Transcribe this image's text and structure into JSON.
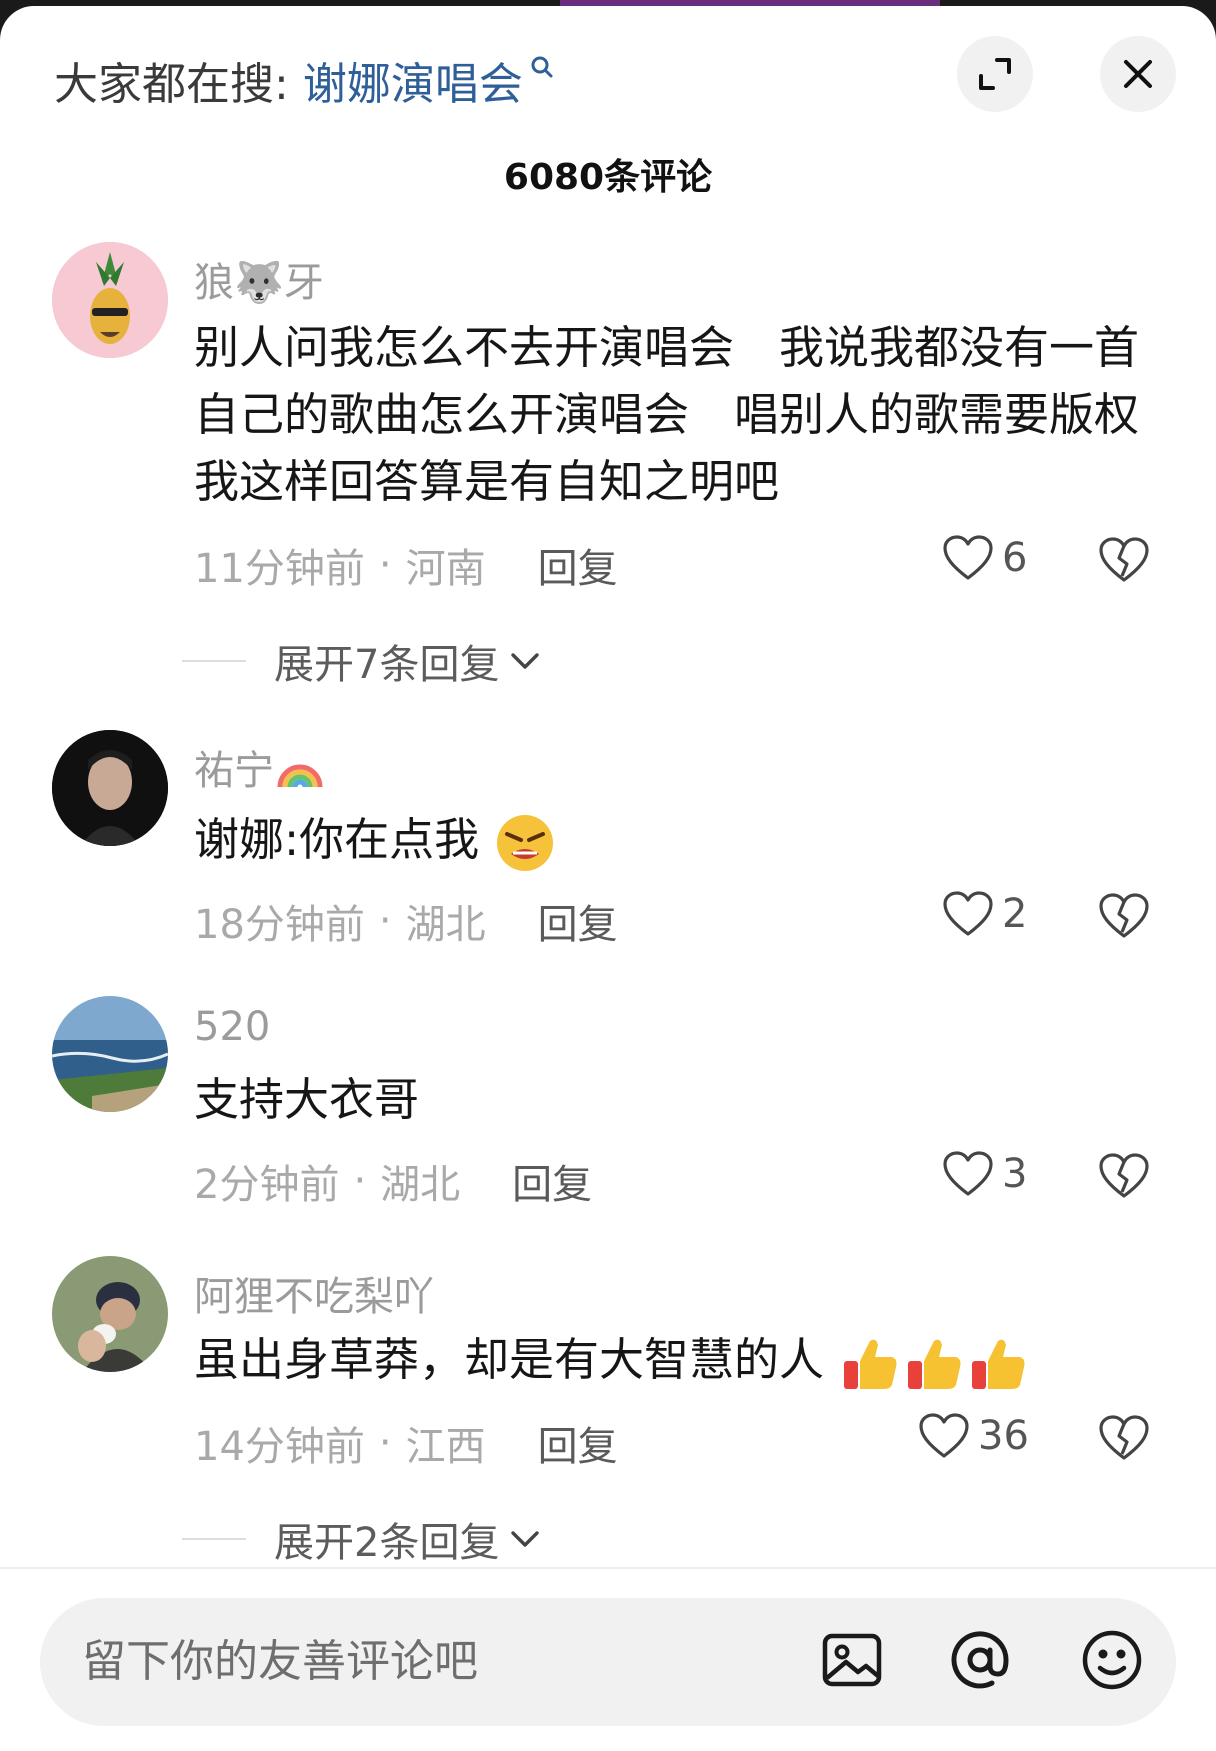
{
  "header": {
    "search_prefix": "大家都在搜:",
    "search_term": "谢娜演唱会",
    "comment_count_title": "6080条评论"
  },
  "comments": [
    {
      "username": "狼🐺牙",
      "text": "别人问我怎么不去开演唱会　我说我都没有一首自己的歌曲怎么开演唱会　唱别人的歌需要版权　我这样回答算是有自知之明吧",
      "time": "11分钟前",
      "location": "河南",
      "reply_label": "回复",
      "likes": "6",
      "expand_replies": "展开7条回复"
    },
    {
      "username": "祐宁",
      "text": "谢娜:你在点我",
      "time": "18分钟前",
      "location": "湖北",
      "reply_label": "回复",
      "likes": "2"
    },
    {
      "username": "520",
      "text": "支持大衣哥",
      "time": "2分钟前",
      "location": "湖北",
      "reply_label": "回复",
      "likes": "3"
    },
    {
      "username": "阿狸不吃梨吖",
      "text": "虽出身草莽，却是有大智慧的人",
      "time": "14分钟前",
      "location": "江西",
      "reply_label": "回复",
      "likes": "36",
      "expand_replies": "展开2条回复"
    }
  ],
  "composer": {
    "placeholder": "留下你的友善评论吧"
  },
  "colors": {
    "link_blue": "#2f5f98",
    "meta_gray": "#a9a9a9"
  },
  "icons": [
    "search-icon",
    "expand-icon",
    "close-icon",
    "heart-icon",
    "broken-heart-icon",
    "chevron-down-icon",
    "image-icon",
    "at-icon",
    "emoji-icon"
  ]
}
